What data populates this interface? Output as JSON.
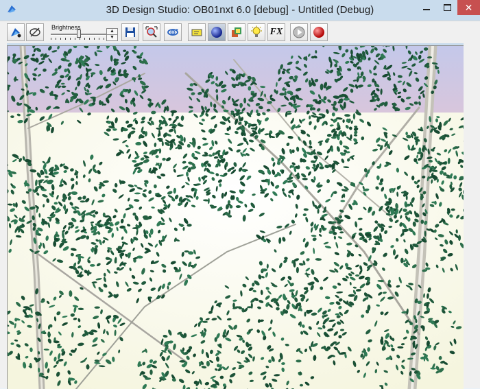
{
  "window": {
    "title": "3D Design Studio: OB01nxt 6.0 [debug] - Untitled (Debug)",
    "close_glyph": "✕"
  },
  "toolbar": {
    "brightness_label": "Brightness",
    "brightness_level": 0.5,
    "spin_up": "▲",
    "spin_down": "▼",
    "fx_label": "FX",
    "icons": [
      "select-icon",
      "orbit-icon",
      "save-icon",
      "zoom-extents-icon",
      "rotate-icon",
      "tag-icon",
      "sphere-icon",
      "materials-icon",
      "light-icon",
      "fx-icon",
      "play-icon",
      "record-icon"
    ]
  },
  "viewport": {
    "scene": "3d-render-trees",
    "sky_top_color": "#c4c8ea",
    "sky_bottom_color": "#d8c6dc",
    "ground_color": "#fbfbe8",
    "foliage_color": "#1f5a3c"
  }
}
